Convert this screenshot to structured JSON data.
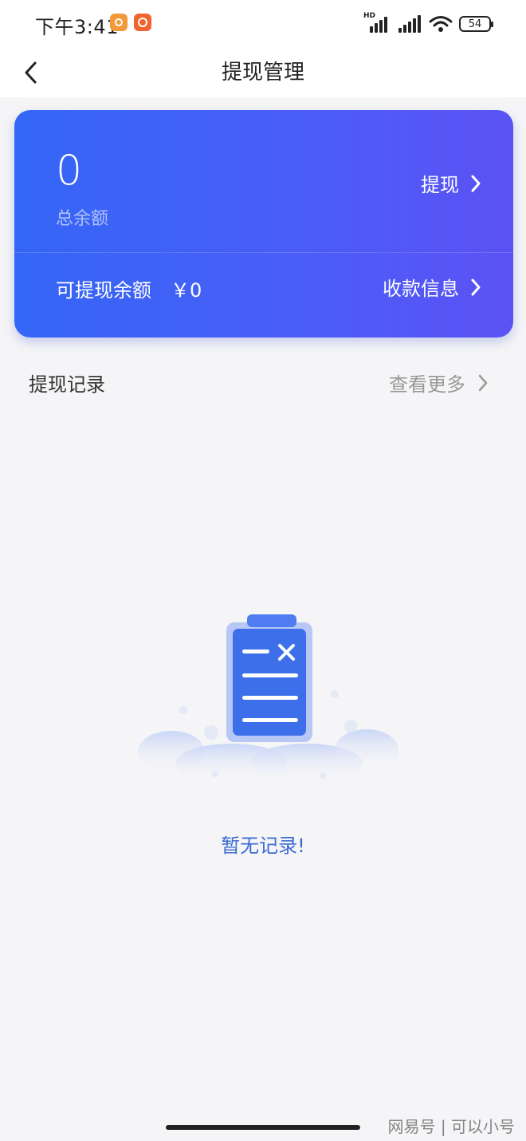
{
  "status_bar": {
    "time": "下午3:41",
    "hd_label": "HD",
    "battery": "54"
  },
  "nav": {
    "title": "提现管理"
  },
  "balance_card": {
    "total_amount": "0",
    "total_label": "总余额",
    "withdraw_label": "提现",
    "available_label": "可提现余额",
    "available_amount": "￥0",
    "payee_label": "收款信息",
    "gradient_start": "#3466f6",
    "gradient_end": "#5b52f4"
  },
  "records": {
    "title": "提现记录",
    "view_more": "查看更多",
    "empty_text": "暂无记录!",
    "empty_icon": "clipboard-empty-icon"
  },
  "watermark": "网易号 | 可以小号",
  "colors": {
    "accent": "#3b6bd3",
    "page_bg": "#f5f5f7"
  }
}
